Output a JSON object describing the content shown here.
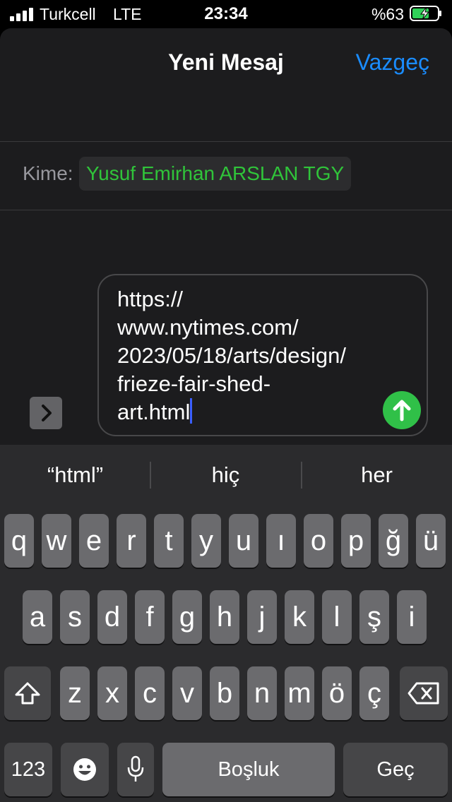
{
  "status_bar": {
    "carrier": "Turkcell",
    "network": "LTE",
    "time": "23:34",
    "battery": "%63"
  },
  "header": {
    "title": "Yeni Mesaj",
    "cancel_label": "Vazgeç"
  },
  "to_field": {
    "label": "Kime:",
    "recipient": "Yusuf  Emirhan ARSLAN TGY"
  },
  "message": {
    "lines": [
      "https://",
      "www.nytimes.com/",
      "2023/05/18/arts/design/",
      "frieze-fair-shed-",
      "art.html"
    ]
  },
  "keyboard": {
    "suggestions": [
      "“html”",
      "hiç",
      "her"
    ],
    "row1": [
      "q",
      "w",
      "e",
      "r",
      "t",
      "y",
      "u",
      "ı",
      "o",
      "p",
      "ğ",
      "ü"
    ],
    "row2": [
      "a",
      "s",
      "d",
      "f",
      "g",
      "h",
      "j",
      "k",
      "l",
      "ş",
      "i"
    ],
    "row3": [
      "z",
      "x",
      "c",
      "v",
      "b",
      "n",
      "m",
      "ö",
      "ç"
    ],
    "numbers_label": "123",
    "space_label": "Boşluk",
    "return_label": "Geç"
  },
  "colors": {
    "accent": "#1a8cff",
    "recipient": "#30c43a",
    "send": "#30c048"
  }
}
